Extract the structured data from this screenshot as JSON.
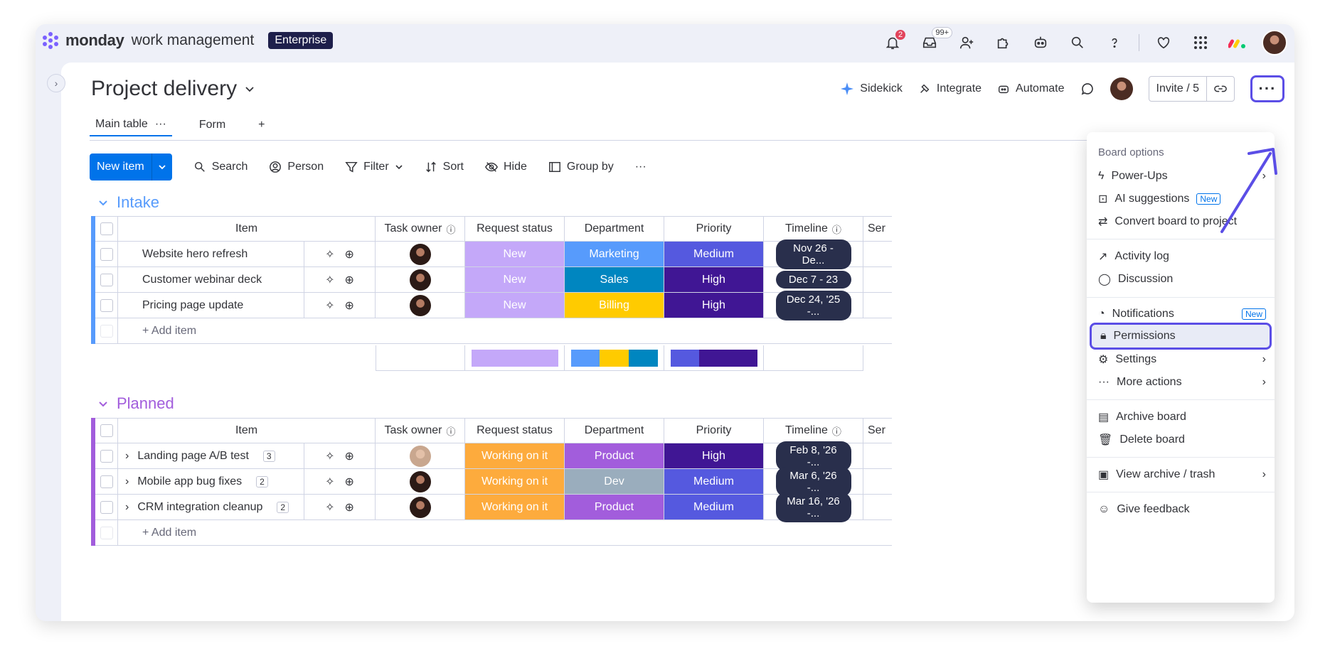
{
  "app": {
    "brand": "monday",
    "product": "work management",
    "plan": "Enterprise"
  },
  "topbar": {
    "notifications_count": "2",
    "inbox_count": "99+"
  },
  "board": {
    "title": "Project delivery"
  },
  "header_actions": {
    "sidekick": "Sidekick",
    "integrate": "Integrate",
    "automate": "Automate",
    "invite": "Invite / 5"
  },
  "views": {
    "tabs": [
      "Main table",
      "Form"
    ],
    "add": "+"
  },
  "toolbar": {
    "new_item": "New item",
    "search": "Search",
    "person": "Person",
    "filter": "Filter",
    "sort": "Sort",
    "hide": "Hide",
    "group_by": "Group by"
  },
  "columns": [
    "Item",
    "Task owner",
    "Request status",
    "Department",
    "Priority",
    "Timeline",
    "Ser"
  ],
  "groups": [
    {
      "title": "Intake",
      "color": "#579bfc",
      "rows": [
        {
          "item": "Website hero refresh",
          "status": "New",
          "status_color": "#c4a8f9",
          "dept": "Marketing",
          "dept_color": "#579bfc",
          "priority": "Medium",
          "priority_color": "#5559df",
          "timeline": "Nov 26 - De..."
        },
        {
          "item": "Customer webinar deck",
          "status": "New",
          "status_color": "#c4a8f9",
          "dept": "Sales",
          "dept_color": "#0086c0",
          "priority": "High",
          "priority_color": "#401694",
          "timeline": "Dec 7 - 23"
        },
        {
          "item": "Pricing page update",
          "status": "New",
          "status_color": "#c4a8f9",
          "dept": "Billing",
          "dept_color": "#ffcb00",
          "priority": "High",
          "priority_color": "#401694",
          "timeline": "Dec 24, '25 -..."
        }
      ],
      "add_item": "+ Add item"
    },
    {
      "title": "Planned",
      "color": "#a25ddc",
      "rows": [
        {
          "item": "Landing page A/B test",
          "count": "3",
          "status": "Working on it",
          "status_color": "#fdab3d",
          "dept": "Product",
          "dept_color": "#a25ddc",
          "priority": "High",
          "priority_color": "#401694",
          "timeline": "Feb 8, '26 -..."
        },
        {
          "item": "Mobile app bug fixes",
          "count": "2",
          "status": "Working on it",
          "status_color": "#fdab3d",
          "dept": "Dev",
          "dept_color": "#9aadbd",
          "priority": "Medium",
          "priority_color": "#5559df",
          "timeline": "Mar 6, '26 -..."
        },
        {
          "item": "CRM integration cleanup",
          "count": "2",
          "status": "Working on it",
          "status_color": "#fdab3d",
          "dept": "Product",
          "dept_color": "#a25ddc",
          "priority": "Medium",
          "priority_color": "#5559df",
          "timeline": "Mar 16, '26 -..."
        }
      ],
      "add_item": "+ Add item"
    }
  ],
  "menu": {
    "heading": "Board options",
    "items": [
      {
        "label": "Power-Ups",
        "icon": "bolt-icon",
        "chevron": true
      },
      {
        "label": "AI suggestions",
        "icon": "ai-icon",
        "tag": "New"
      },
      {
        "label": "Convert board to project",
        "icon": "convert-icon"
      },
      {
        "label": "Activity log",
        "icon": "activity-icon"
      },
      {
        "label": "Discussion",
        "icon": "chat-icon"
      },
      {
        "label": "Notifications",
        "icon": "bell-icon",
        "tag": "New"
      },
      {
        "label": "Permissions",
        "icon": "lock-icon"
      },
      {
        "label": "Settings",
        "icon": "gear-icon",
        "chevron": true
      },
      {
        "label": "More actions",
        "icon": "dots-icon",
        "chevron": true
      },
      {
        "label": "Archive board",
        "icon": "archive-icon"
      },
      {
        "label": "Delete board",
        "icon": "trash-icon"
      },
      {
        "label": "View archive / trash",
        "icon": "archive-view-icon",
        "chevron": true
      },
      {
        "label": "Give feedback",
        "icon": "feedback-icon"
      }
    ]
  },
  "colors": {
    "accent": "#0073ea",
    "highlight": "#5b4ee6"
  }
}
